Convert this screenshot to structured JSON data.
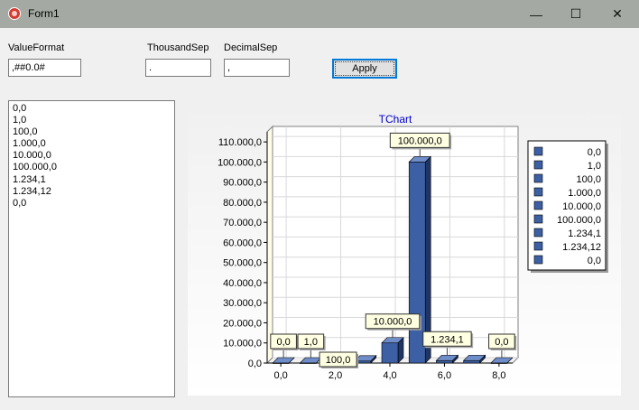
{
  "window": {
    "title": "Form1",
    "minimize": "—",
    "maximize": "☐",
    "close": "✕"
  },
  "form": {
    "value_format_label": "ValueFormat",
    "value_format_value": ",##0.0#",
    "thousand_sep_label": "ThousandSep",
    "thousand_sep_value": ".",
    "decimal_sep_label": "DecimalSep",
    "decimal_sep_value": ",",
    "apply_label": "Apply"
  },
  "memo_lines": [
    "0,0",
    "1,0",
    "100,0",
    "1.000,0",
    "10.000,0",
    "100.000,0",
    "1.234,1",
    "1.234,12",
    "0,0"
  ],
  "colors": {
    "bar": "#3d5fa3",
    "bar_side": "#1f3566",
    "bar_top": "#6f8dc8",
    "title": "#0000cc"
  },
  "chart_data": {
    "type": "bar",
    "title": "TChart",
    "x": [
      0,
      1,
      2,
      3,
      4,
      5,
      6,
      7,
      8
    ],
    "values": [
      0,
      1,
      100,
      1000,
      10000,
      100000,
      1234.1,
      1234.12,
      0
    ],
    "x_ticks": [
      0,
      2,
      4,
      6,
      8
    ],
    "x_tick_labels": [
      "0,0",
      "2,0",
      "4,0",
      "6,0",
      "8,0"
    ],
    "ylim": [
      0,
      115000
    ],
    "y_ticks": [
      0,
      10000,
      20000,
      30000,
      40000,
      50000,
      60000,
      70000,
      80000,
      90000,
      100000,
      110000
    ],
    "y_tick_labels": [
      "0,0",
      "10.000,0",
      "20.000,0",
      "30.000,0",
      "40.000,0",
      "50.000,0",
      "60.000,0",
      "70.000,0",
      "80.000,0",
      "90.000,0",
      "100.000,0",
      "110.000,0"
    ],
    "marks": [
      {
        "index": 0,
        "text": "0,0"
      },
      {
        "index": 1,
        "text": "1,0"
      },
      {
        "index": 2,
        "text": "100,0"
      },
      {
        "index": 4,
        "text": "10.000,0"
      },
      {
        "index": 5,
        "text": "100.000,0"
      },
      {
        "index": 6,
        "text": "1.234,1"
      },
      {
        "index": 8,
        "text": "0,0"
      }
    ],
    "legend": [
      "0,0",
      "1,0",
      "100,0",
      "1.000,0",
      "10.000,0",
      "100.000,0",
      "1.234,1",
      "1.234,12",
      "0,0"
    ],
    "legend_position": "right",
    "grid": true,
    "view_3d": true
  }
}
